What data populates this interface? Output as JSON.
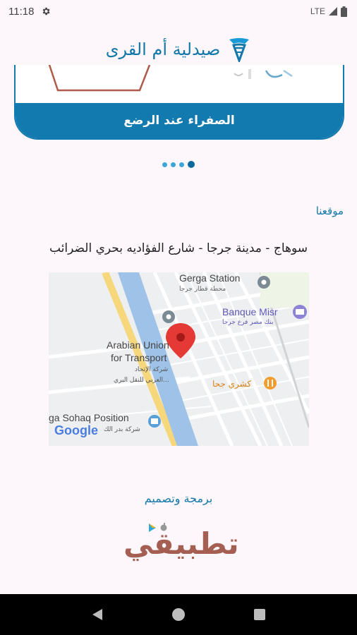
{
  "status_bar": {
    "time": "11:18",
    "network": "LTE",
    "icons": [
      "gear-icon",
      "signal-icon",
      "battery-icon"
    ]
  },
  "header": {
    "title": "صيدلية أم القرى",
    "logo_icon": "pharmacy-logo-icon"
  },
  "slider": {
    "caption": "الصفراء عند الرضع",
    "dot_count": 4,
    "active_index": 3
  },
  "location": {
    "section_title": "موقعنا",
    "address": "سوهاج - مدينة جرجا - شارع الفؤاديه بحري الضرائب"
  },
  "map": {
    "labels": {
      "gerga_station": "Gerga Station",
      "gerga_station_ar": "محطة قطار جرجا",
      "banque_misr": "Banque Misr",
      "banque_misr_ar": "بنك مصر فرع جرجا",
      "arabian_union_1": "Arabian Union",
      "arabian_union_2": "for Transport",
      "arabian_union_ar_1": "شركة الإتحاد",
      "arabian_union_ar_2": "العربي للنقل البري...",
      "koshary": "كشري جحا",
      "sohaq_position": "ga Sohaq Position",
      "sohaq_ar": "شركة بدر الك",
      "google": "Google"
    }
  },
  "credits": {
    "title": "برمجة وتصميم",
    "brand": "تطبيقي"
  },
  "colors": {
    "brand": "#1377a8",
    "caption_bg": "#137ab0",
    "background": "#fdf7fb",
    "pin": "#e53935"
  },
  "nav_bar": {
    "icons": [
      "back-icon",
      "home-icon",
      "recents-icon"
    ]
  }
}
